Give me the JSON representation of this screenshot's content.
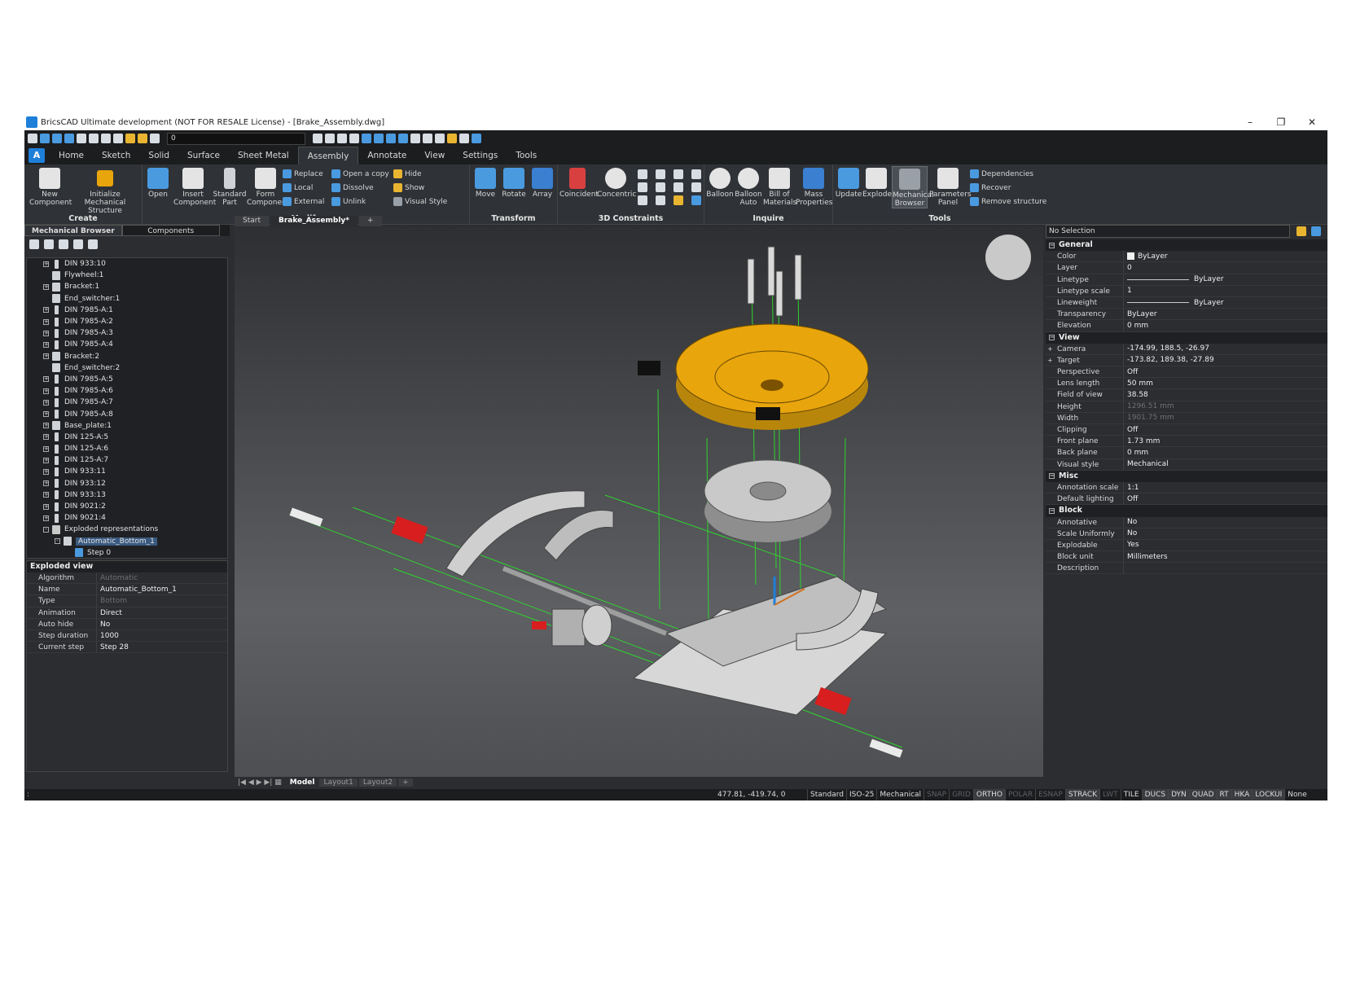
{
  "window": {
    "title": "BricsCAD Ultimate development (NOT FOR RESALE License) - [Brake_Assembly.dwg]",
    "controls": [
      "–",
      "❐",
      "✕"
    ]
  },
  "qat": {
    "layer_value": "0"
  },
  "ribbon_tabs": [
    "Home",
    "Sketch",
    "Solid",
    "Surface",
    "Sheet Metal",
    "Assembly",
    "Annotate",
    "View",
    "Settings",
    "Tools"
  ],
  "ribbon": {
    "create": {
      "title": "Create",
      "new_component": "New Component",
      "init_mech": "Initialize Mechanical Structure"
    },
    "modify": {
      "title": "Modify",
      "open": "Open",
      "insert": "Insert Component",
      "standard": "Standard Part",
      "form": "Form Component",
      "replace": "Replace",
      "local": "Local",
      "external": "External",
      "open_copy": "Open a copy",
      "dissolve": "Dissolve",
      "unlink": "Unlink",
      "hide": "Hide",
      "show": "Show",
      "visual_style": "Visual Style"
    },
    "transform": {
      "title": "Transform",
      "move": "Move",
      "rotate": "Rotate",
      "array": "Array"
    },
    "constraints": {
      "title": "3D Constraints",
      "coincident": "Coincident",
      "concentric": "Concentric"
    },
    "inquire": {
      "title": "Inquire",
      "balloon": "Balloon",
      "balloon_auto": "Balloon Auto",
      "bom": "Bill of Materials",
      "mass": "Mass Properties"
    },
    "tools": {
      "title": "Tools",
      "update": "Update",
      "explode": "Explode",
      "mech_browser": "Mechanical Browser",
      "params": "Parameters Panel",
      "dependencies": "Dependencies",
      "recover": "Recover",
      "remove": "Remove structure"
    }
  },
  "left_panel": {
    "tabs": [
      "Mechanical Browser",
      "Components"
    ],
    "tree": [
      {
        "label": "DIN 933:10",
        "exp": "+",
        "icon": "bolt"
      },
      {
        "label": "Flywheel:1",
        "exp": "",
        "icon": "cube"
      },
      {
        "label": "Bracket:1",
        "exp": "+",
        "icon": "cube"
      },
      {
        "label": "End_switcher:1",
        "exp": "",
        "icon": "cube"
      },
      {
        "label": "DIN 7985-A:1",
        "exp": "+",
        "icon": "bolt"
      },
      {
        "label": "DIN 7985-A:2",
        "exp": "+",
        "icon": "bolt"
      },
      {
        "label": "DIN 7985-A:3",
        "exp": "+",
        "icon": "bolt"
      },
      {
        "label": "DIN 7985-A:4",
        "exp": "+",
        "icon": "bolt"
      },
      {
        "label": "Bracket:2",
        "exp": "+",
        "icon": "cube"
      },
      {
        "label": "End_switcher:2",
        "exp": "",
        "icon": "cube"
      },
      {
        "label": "DIN 7985-A:5",
        "exp": "+",
        "icon": "bolt"
      },
      {
        "label": "DIN 7985-A:6",
        "exp": "+",
        "icon": "bolt"
      },
      {
        "label": "DIN 7985-A:7",
        "exp": "+",
        "icon": "bolt"
      },
      {
        "label": "DIN 7985-A:8",
        "exp": "+",
        "icon": "bolt"
      },
      {
        "label": "Base_plate:1",
        "exp": "+",
        "icon": "cube"
      },
      {
        "label": "DIN 125-A:5",
        "exp": "+",
        "icon": "bolt"
      },
      {
        "label": "DIN 125-A:6",
        "exp": "+",
        "icon": "bolt"
      },
      {
        "label": "DIN 125-A:7",
        "exp": "+",
        "icon": "bolt"
      },
      {
        "label": "DIN 933:11",
        "exp": "+",
        "icon": "bolt"
      },
      {
        "label": "DIN 933:12",
        "exp": "+",
        "icon": "bolt"
      },
      {
        "label": "DIN 933:13",
        "exp": "+",
        "icon": "bolt"
      },
      {
        "label": "DIN 9021:2",
        "exp": "+",
        "icon": "bolt"
      },
      {
        "label": "DIN 9021:4",
        "exp": "+",
        "icon": "bolt"
      },
      {
        "label": "Exploded representations",
        "exp": "-",
        "icon": "folder"
      },
      {
        "label": "Automatic_Bottom_1",
        "exp": "-",
        "icon": "cube",
        "indent": 1,
        "selected": true
      },
      {
        "label": "Step 0",
        "exp": "",
        "icon": "step",
        "indent": 2
      }
    ],
    "exploded_view": {
      "header": "Exploded view",
      "rows": [
        {
          "k": "Algorithm",
          "v": "Automatic",
          "grey": true
        },
        {
          "k": "Name",
          "v": "Automatic_Bottom_1"
        },
        {
          "k": "Type",
          "v": "Bottom",
          "grey": true
        },
        {
          "k": "Animation",
          "v": "Direct"
        },
        {
          "k": "Auto hide",
          "v": "No"
        },
        {
          "k": "Step duration",
          "v": "1000"
        },
        {
          "k": "Current step",
          "v": "Step 28"
        }
      ]
    }
  },
  "doc_tabs": [
    "Start",
    "Brake_Assembly*"
  ],
  "layout_tabs": [
    "Model",
    "Layout1",
    "Layout2"
  ],
  "right_panel": {
    "selection": "No Selection",
    "sections": [
      {
        "title": "General",
        "rows": [
          {
            "k": "Color",
            "v": "ByLayer",
            "swatch": true
          },
          {
            "k": "Layer",
            "v": "0"
          },
          {
            "k": "Linetype",
            "v": "ByLayer",
            "line": true
          },
          {
            "k": "Linetype scale",
            "v": "1"
          },
          {
            "k": "Lineweight",
            "v": "ByLayer",
            "line": true
          },
          {
            "k": "Transparency",
            "v": "ByLayer"
          },
          {
            "k": "Elevation",
            "v": "0 mm"
          }
        ]
      },
      {
        "title": "View",
        "rows": [
          {
            "k": "Camera",
            "v": "-174.99, 188.5, -26.97",
            "exp": true
          },
          {
            "k": "Target",
            "v": "-173.82, 189.38, -27.89",
            "exp": true
          },
          {
            "k": "Perspective",
            "v": "Off"
          },
          {
            "k": "Lens length",
            "v": "50 mm"
          },
          {
            "k": "Field of view",
            "v": "38.58"
          },
          {
            "k": "Height",
            "v": "1296.51 mm",
            "grey": true
          },
          {
            "k": "Width",
            "v": "1901.75 mm",
            "grey": true
          },
          {
            "k": "Clipping",
            "v": "Off"
          },
          {
            "k": "Front plane",
            "v": "1.73 mm"
          },
          {
            "k": "Back plane",
            "v": "0 mm"
          },
          {
            "k": "Visual style",
            "v": "Mechanical"
          }
        ]
      },
      {
        "title": "Misc",
        "rows": [
          {
            "k": "Annotation scale",
            "v": "1:1"
          },
          {
            "k": "Default lighting",
            "v": "Off"
          }
        ]
      },
      {
        "title": "Block",
        "rows": [
          {
            "k": "Annotative",
            "v": "No"
          },
          {
            "k": "Scale Uniformly",
            "v": "No"
          },
          {
            "k": "Explodable",
            "v": "Yes"
          },
          {
            "k": "Block unit",
            "v": "Millimeters"
          },
          {
            "k": "Description",
            "v": ""
          }
        ]
      }
    ]
  },
  "status": {
    "coords": "477.81, -419.74, 0",
    "items": [
      {
        "t": "Standard",
        "s": "n"
      },
      {
        "t": "ISO-25",
        "s": "n"
      },
      {
        "t": "Mechanical",
        "s": "n"
      },
      {
        "t": "SNAP",
        "s": "off"
      },
      {
        "t": "GRID",
        "s": "off"
      },
      {
        "t": "ORTHO",
        "s": "on"
      },
      {
        "t": "POLAR",
        "s": "off"
      },
      {
        "t": "ESNAP",
        "s": "off"
      },
      {
        "t": "STRACK",
        "s": "on"
      },
      {
        "t": "LWT",
        "s": "off"
      },
      {
        "t": "TILE",
        "s": "n"
      },
      {
        "t": "DUCS",
        "s": "on"
      },
      {
        "t": "DYN",
        "s": "on"
      },
      {
        "t": "QUAD",
        "s": "on"
      },
      {
        "t": "RT",
        "s": "on"
      },
      {
        "t": "HKA",
        "s": "on"
      },
      {
        "t": "LOCKUI",
        "s": "on"
      },
      {
        "t": "None",
        "s": "n"
      }
    ]
  },
  "colors": {
    "accent": "#e8a50c",
    "highlight": "#1e7fd9",
    "green_lines": "#2fd42f",
    "red_parts": "#d81e1e"
  }
}
